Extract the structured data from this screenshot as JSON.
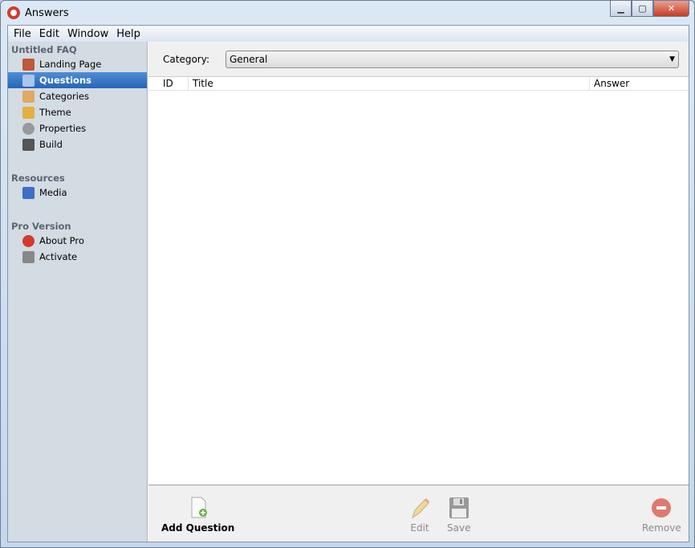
{
  "window": {
    "title": "Answers",
    "controls": [
      "minimize",
      "maximize",
      "close"
    ]
  },
  "menu": [
    "File",
    "Edit",
    "Window",
    "Help"
  ],
  "sidebar": {
    "groups": [
      {
        "label": "Untitled FAQ",
        "items": [
          {
            "label": "Landing Page",
            "icon": "house-icon"
          },
          {
            "label": "Questions",
            "icon": "speech-bubble-icon",
            "selected": true
          },
          {
            "label": "Categories",
            "icon": "box-icon"
          },
          {
            "label": "Theme",
            "icon": "pencil-icon"
          },
          {
            "label": "Properties",
            "icon": "gear-icon"
          },
          {
            "label": "Build",
            "icon": "hammer-icon"
          }
        ]
      },
      {
        "label": "Resources",
        "items": [
          {
            "label": "Media",
            "icon": "media-icon"
          }
        ]
      },
      {
        "label": "Pro Version",
        "items": [
          {
            "label": "About Pro",
            "icon": "lifebuoy-icon"
          },
          {
            "label": "Activate",
            "icon": "key-icon"
          }
        ]
      }
    ]
  },
  "main": {
    "category_label": "Category:",
    "category_value": "General",
    "columns": [
      "ID",
      "Title",
      "Answer"
    ]
  },
  "toolbar": {
    "add": "Add Question",
    "edit": "Edit",
    "save": "Save",
    "remove": "Remove"
  },
  "colors": {
    "selection": "#2f6fc2",
    "sidebar": "#d3dbe3",
    "remove": "#e07a70"
  }
}
